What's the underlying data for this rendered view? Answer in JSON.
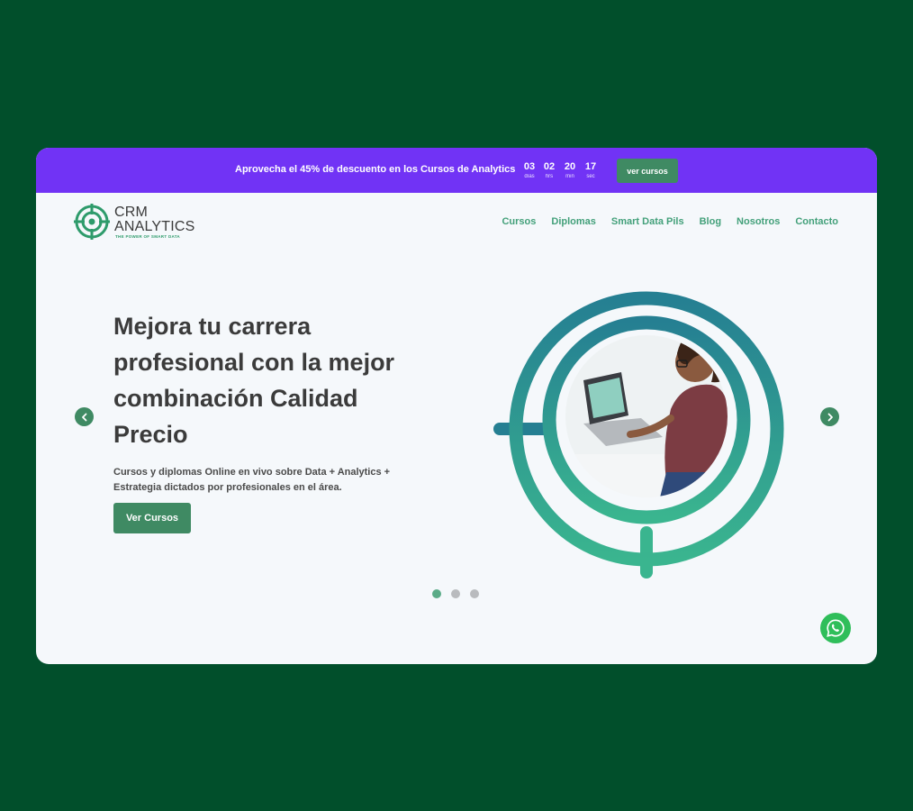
{
  "promo": {
    "text": "Aprovecha el 45% de descuento en los Cursos de Analytics",
    "countdown": [
      {
        "value": "03",
        "label": "días"
      },
      {
        "value": "02",
        "label": "hrs"
      },
      {
        "value": "20",
        "label": "min"
      },
      {
        "value": "17",
        "label": "sec"
      }
    ],
    "button_label": "ver cursos"
  },
  "logo": {
    "line1": "CRM",
    "line2": "ANALYTICS",
    "tagline": "THE POWER OF SMART DATA"
  },
  "nav": {
    "items": [
      "Cursos",
      "Diplomas",
      "Smart Data Pils",
      "Blog",
      "Nosotros",
      "Contacto"
    ]
  },
  "hero": {
    "title": "Mejora tu carrera profesional con la mejor combinación Calidad Precio",
    "subtitle": "Cursos y diplomas Online en vivo sobre Data + Analytics + Estrategia dictados por profesionales en el área.",
    "button_label": "Ver Cursos"
  },
  "carousel": {
    "slide_count": 3,
    "active_index": 0
  },
  "colors": {
    "background": "#014f2b",
    "promo_bar": "#7133f5",
    "primary_green": "#3f8a63",
    "nav_text": "#43a07a",
    "whatsapp": "#2fbe5a"
  }
}
